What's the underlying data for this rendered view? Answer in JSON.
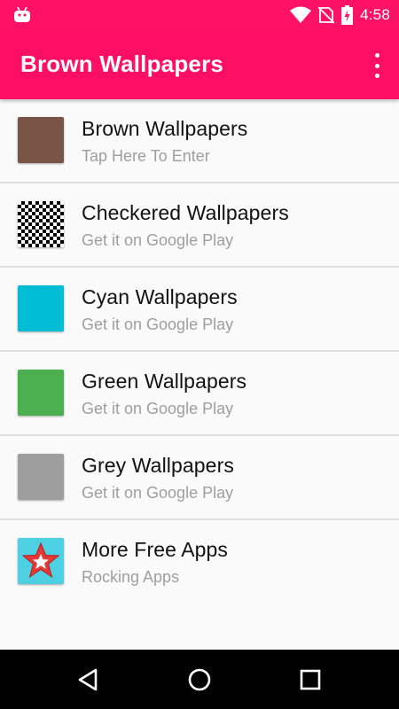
{
  "status_bar": {
    "time": "4:58",
    "icons": [
      "android-icon",
      "wifi-icon",
      "no-sim-icon",
      "battery-charging-icon"
    ]
  },
  "app_bar": {
    "title": "Brown Wallpapers",
    "menu_icon": "overflow-menu-icon"
  },
  "items": [
    {
      "title": "Brown Wallpapers",
      "subtitle": "Tap Here To Enter",
      "color": "#795548"
    },
    {
      "title": "Checkered Wallpapers",
      "subtitle": "Get it on Google Play",
      "color": "checkered"
    },
    {
      "title": "Cyan Wallpapers",
      "subtitle": "Get it on Google Play",
      "color": "#00bcd4"
    },
    {
      "title": "Green Wallpapers",
      "subtitle": "Get it on Google Play",
      "color": "#4caf50"
    },
    {
      "title": "Grey Wallpapers",
      "subtitle": "Get it on Google Play",
      "color": "#9e9e9e"
    },
    {
      "title": "More Free Apps",
      "subtitle": "Rocking Apps",
      "color": "#4dd0e1"
    }
  ],
  "nav_bar": {
    "buttons": [
      "back-icon",
      "home-icon",
      "recents-icon"
    ]
  },
  "colors": {
    "status_bar": "#ff1166",
    "app_bar": "#ff0f63",
    "background": "#fafafa",
    "divider": "#e0e0e0"
  }
}
